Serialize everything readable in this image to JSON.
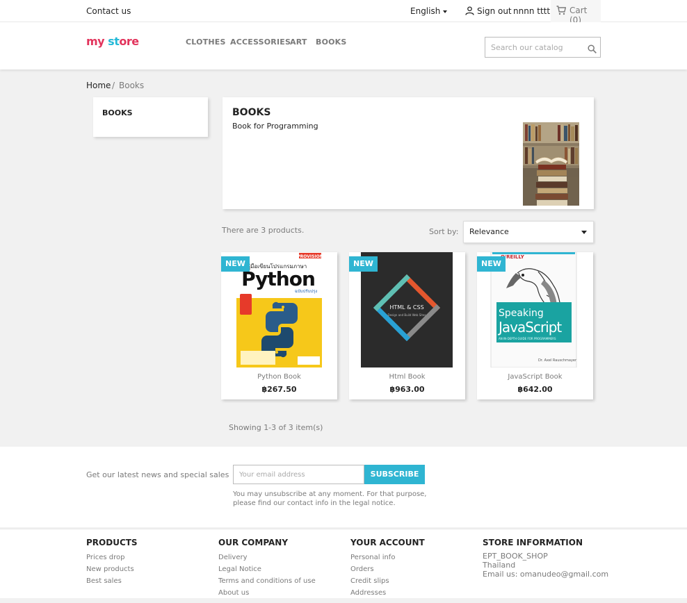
{
  "topnav": {
    "contact": "Contact us",
    "language": "English",
    "sign_out": "Sign out",
    "username": "nnnn tttt",
    "cart": "Cart (0)"
  },
  "header": {
    "logo": {
      "part1": "my",
      "part2": " st",
      "part3": "ore"
    },
    "menu": [
      "CLOTHES",
      "ACCESSORIES",
      "ART",
      "BOOKS"
    ],
    "search_placeholder": "Search our catalog"
  },
  "breadcrumb": {
    "home": "Home",
    "separator": "/",
    "current": "Books"
  },
  "left_column": {
    "title": "BOOKS"
  },
  "category": {
    "title": "BOOKS",
    "description": "Book for Programming"
  },
  "listing": {
    "count": "There are 3 products.",
    "sort_label": "Sort by:",
    "sort_value": "Relevance",
    "showing": "Showing 1-3 of 3 item(s)"
  },
  "products": [
    {
      "flag": "NEW",
      "name": "Python Book",
      "price": "฿267.50",
      "cover_title": "Python",
      "cover_sub": "คู่มือเขียนโปรแกรมภาษา",
      "cover_sub2": "ฉบับปรับปรุง",
      "brand": "PROVISION"
    },
    {
      "flag": "NEW",
      "name": "Html Book",
      "price": "฿963.00",
      "cover_title": "HTML & CSS",
      "cover_sub": "Design and Build Web Sites"
    },
    {
      "flag": "NEW",
      "name": "JavaScript Book",
      "price": "฿642.00",
      "cover_title1": "Speaking",
      "cover_title2": "JavaScript",
      "publisher": "O'REILLY",
      "cover_sub": "AN IN-DEPTH GUIDE FOR PROGRAMMERS",
      "author": "Dr. Axel Rauschmayer"
    }
  ],
  "newsletter": {
    "label": "Get our latest news and special sales",
    "placeholder": "Your email address",
    "button": "SUBSCRIBE",
    "note_line1": "You may unsubscribe at any moment. For that purpose,",
    "note_line2": "please find our contact info in the legal notice."
  },
  "footer": {
    "products": {
      "title": "PRODUCTS",
      "links": [
        "Prices drop",
        "New products",
        "Best sales"
      ]
    },
    "company": {
      "title": "OUR COMPANY",
      "links": [
        "Delivery",
        "Legal Notice",
        "Terms and conditions of use",
        "About us"
      ]
    },
    "account": {
      "title": "YOUR ACCOUNT",
      "links": [
        "Personal info",
        "Orders",
        "Credit slips",
        "Addresses"
      ]
    },
    "store": {
      "title": "STORE INFORMATION",
      "lines": [
        "EPT_BOOK_SHOP",
        "Thailand",
        "Email us: omanudeo@gmail.com"
      ]
    }
  },
  "colors": {
    "accent": "#2fb5d2",
    "brand_pink": "#e2345c",
    "brand_blue": "#25b9d7",
    "brand_yellow": "#f3b424"
  },
  "icons": [
    "user-icon",
    "cart-icon",
    "search-icon",
    "caret-down-icon"
  ]
}
